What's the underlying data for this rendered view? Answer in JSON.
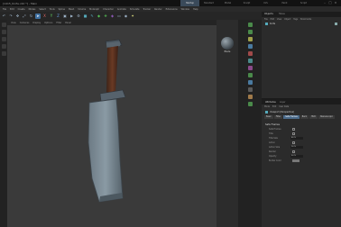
{
  "window": {
    "title": "[1415_Knife.c4d *] - Main",
    "layout_tabs": [
      "Startup",
      "Standard",
      "Model",
      "Sculpt",
      "UVs",
      "Paint",
      "Script"
    ],
    "active_tab_index": 0
  },
  "menubar": {
    "items": [
      "File",
      "Edit",
      "Create",
      "Modes",
      "Select",
      "Tools",
      "Spline",
      "Mesh",
      "Volume",
      "MoGraph",
      "Character",
      "Animate",
      "Simulate",
      "Tracker",
      "Render",
      "Extensions",
      "Window",
      "Help"
    ]
  },
  "viewport": {
    "menu": [
      "View",
      "Cameras",
      "Display",
      "Options",
      "Filter",
      "Panel"
    ]
  },
  "materials": {
    "swatch_label": "Blade"
  },
  "objects": {
    "header": "Objects",
    "header2": "Takes",
    "menu": [
      "File",
      "Edit",
      "View",
      "Object",
      "Tags",
      "Bookmarks"
    ],
    "rows": [
      "Knife"
    ]
  },
  "attributes": {
    "header": "Attributes",
    "header2": "Layer",
    "menu": [
      "Mode",
      "Edit",
      "User Data"
    ],
    "object_name": "Viewport [Perspective]",
    "tabs": [
      "Basic",
      "Filter",
      "Safe Frames",
      "Back",
      "HUD",
      "Stereoscopic"
    ],
    "active_tab_index": 2,
    "section_title": "Safe Frames",
    "fields": [
      {
        "label": "Safe Frames",
        "value": ""
      },
      {
        "label": "Title",
        "value": ""
      },
      {
        "label": "Title Size",
        "value": "80 %"
      },
      {
        "label": "Action",
        "value": ""
      },
      {
        "label": "Action Size",
        "value": "90 %"
      },
      {
        "label": "Render",
        "value": ""
      },
      {
        "label": "Opacity",
        "value": "50 %"
      },
      {
        "label": "Border Color",
        "value": ""
      }
    ]
  },
  "colors": {
    "accent": "#4a6a8a",
    "viewport_bg": "#3a3a3a"
  }
}
